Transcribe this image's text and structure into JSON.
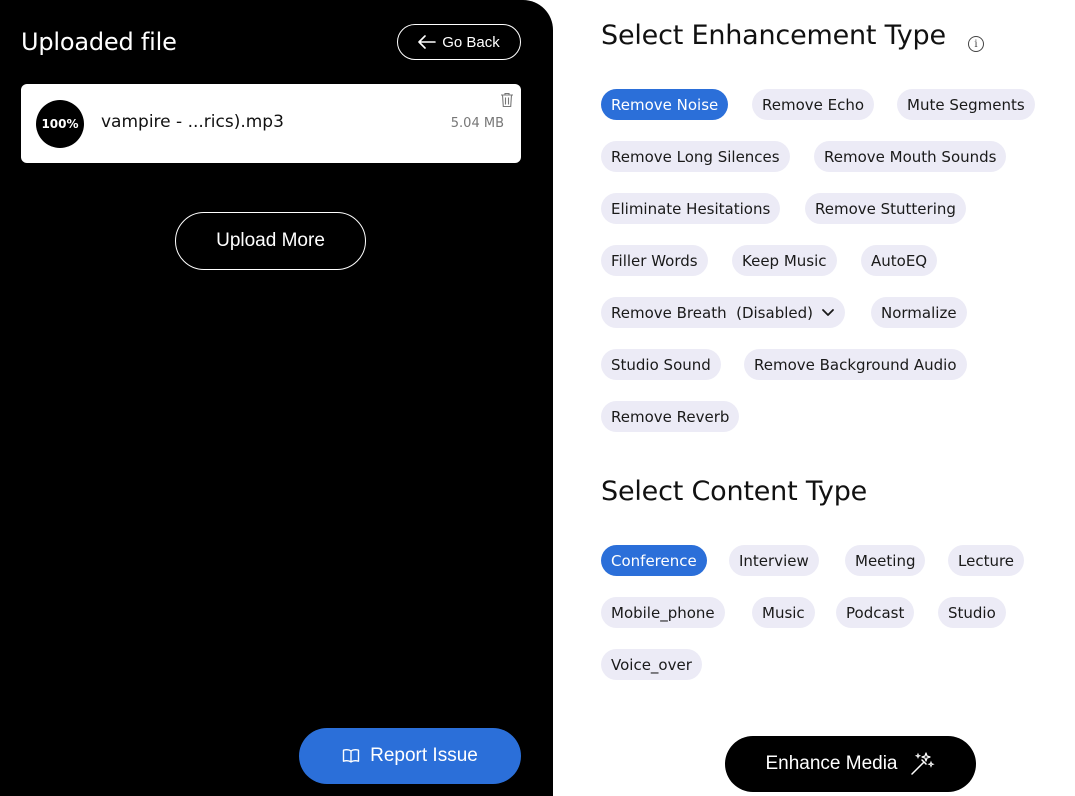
{
  "left": {
    "title": "Uploaded file",
    "go_back_label": "Go Back",
    "file": {
      "progress": "100%",
      "name": "vampire - ...rics).mp3",
      "size": "5.04 MB"
    },
    "upload_more_label": "Upload More",
    "report_issue_label": "Report Issue"
  },
  "enhancement": {
    "title": "Select Enhancement Type",
    "info_glyph": "i",
    "options": [
      {
        "label": "Remove Noise",
        "selected": true
      },
      {
        "label": "Remove Echo",
        "selected": false
      },
      {
        "label": "Mute Segments",
        "selected": false
      },
      {
        "label": "Remove Long Silences",
        "selected": false
      },
      {
        "label": "Remove Mouth Sounds",
        "selected": false
      },
      {
        "label": "Eliminate Hesitations",
        "selected": false
      },
      {
        "label": "Remove Stuttering",
        "selected": false
      },
      {
        "label": "Filler Words",
        "selected": false
      },
      {
        "label": "Keep Music",
        "selected": false
      },
      {
        "label": "AutoEQ",
        "selected": false
      },
      {
        "label": "Remove Breath  (Disabled)",
        "selected": false
      },
      {
        "label": "Normalize",
        "selected": false
      },
      {
        "label": "Studio Sound",
        "selected": false
      },
      {
        "label": "Remove Background Audio",
        "selected": false
      },
      {
        "label": "Remove Reverb",
        "selected": false
      }
    ]
  },
  "content": {
    "title": "Select Content Type",
    "options": [
      {
        "label": "Conference",
        "selected": true
      },
      {
        "label": "Interview",
        "selected": false
      },
      {
        "label": "Meeting",
        "selected": false
      },
      {
        "label": "Lecture",
        "selected": false
      },
      {
        "label": "Mobile_phone",
        "selected": false
      },
      {
        "label": "Music",
        "selected": false
      },
      {
        "label": "Podcast",
        "selected": false
      },
      {
        "label": "Studio",
        "selected": false
      },
      {
        "label": "Voice_over",
        "selected": false
      }
    ]
  },
  "enhance_label": "Enhance Media",
  "colors": {
    "accent": "#2b6fd9",
    "chip_bg": "#ecebf6",
    "panel_bg": "#000000"
  }
}
